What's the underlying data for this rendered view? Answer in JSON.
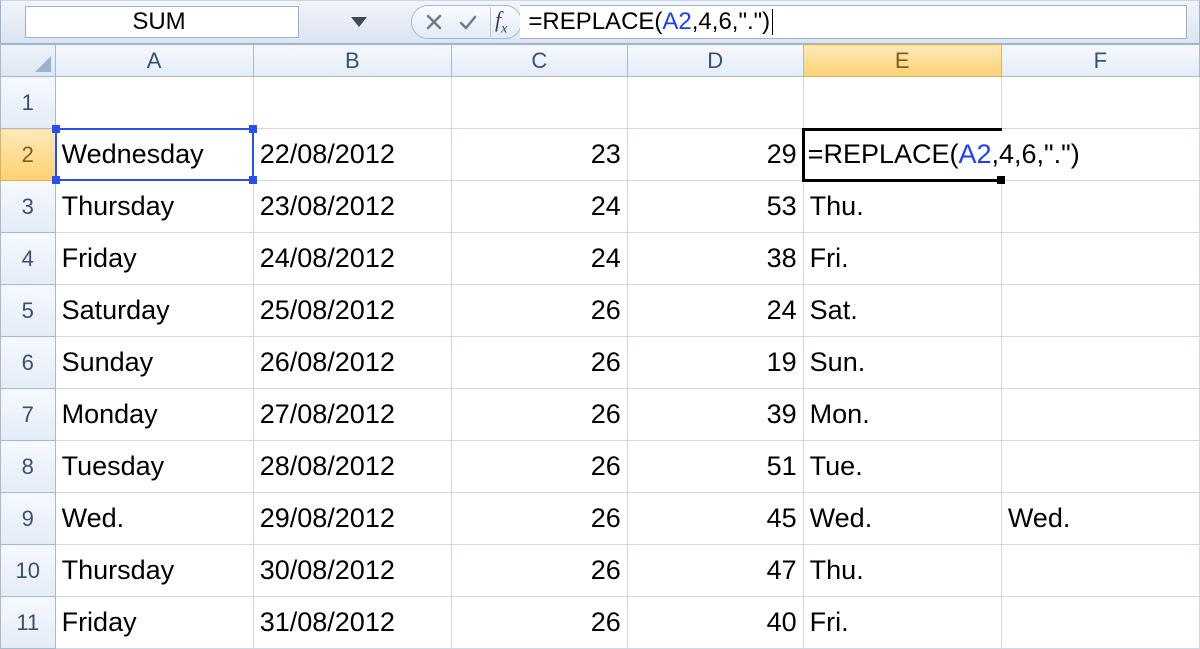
{
  "nameBox": "SUM",
  "formula": {
    "prefix": "=REPLACE(",
    "ref": "A2",
    "suffix": ",4,6,\".\")"
  },
  "columns": [
    "A",
    "B",
    "C",
    "D",
    "E",
    "F"
  ],
  "rowNumbers": [
    "1",
    "2",
    "3",
    "4",
    "5",
    "6",
    "7",
    "8",
    "9",
    "10",
    "11"
  ],
  "activeRow": 2,
  "activeCol": "E",
  "chart_data": {
    "type": "table",
    "columns": [
      "A",
      "B",
      "C",
      "D",
      "E",
      "F"
    ],
    "rows": [
      {
        "A": "",
        "B": "",
        "C": "",
        "D": "",
        "E": "",
        "F": ""
      },
      {
        "A": "Wednesday",
        "B": "22/08/2012",
        "C": "23",
        "D": "29",
        "E": "=REPLACE(A2,4,6,\".\")",
        "F": ""
      },
      {
        "A": "Thursday",
        "B": "23/08/2012",
        "C": "24",
        "D": "53",
        "E": "Thu.",
        "F": ""
      },
      {
        "A": "Friday",
        "B": "24/08/2012",
        "C": "24",
        "D": "38",
        "E": "Fri.",
        "F": ""
      },
      {
        "A": "Saturday",
        "B": "25/08/2012",
        "C": "26",
        "D": "24",
        "E": "Sat.",
        "F": ""
      },
      {
        "A": "Sunday",
        "B": "26/08/2012",
        "C": "26",
        "D": "19",
        "E": "Sun.",
        "F": ""
      },
      {
        "A": "Monday",
        "B": "27/08/2012",
        "C": "26",
        "D": "39",
        "E": "Mon.",
        "F": ""
      },
      {
        "A": "Tuesday",
        "B": "28/08/2012",
        "C": "26",
        "D": "51",
        "E": "Tue.",
        "F": ""
      },
      {
        "A": "Wed.",
        "B": "29/08/2012",
        "C": "26",
        "D": "45",
        "E": "Wed.",
        "F": "Wed."
      },
      {
        "A": "Thursday",
        "B": "30/08/2012",
        "C": "26",
        "D": "47",
        "E": "Thu.",
        "F": ""
      },
      {
        "A": "Friday",
        "B": "31/08/2012",
        "C": "26",
        "D": "40",
        "E": "Fri.",
        "F": ""
      }
    ]
  }
}
